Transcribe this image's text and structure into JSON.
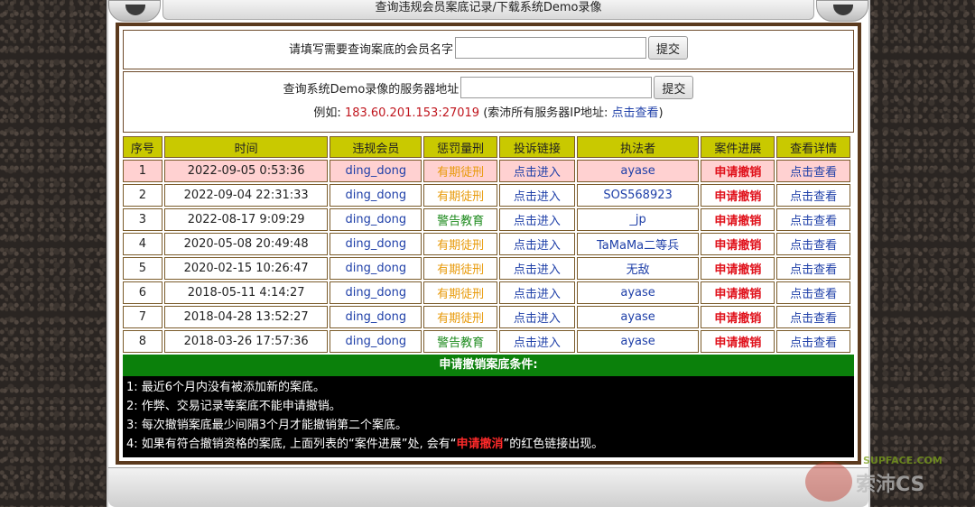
{
  "header": {
    "title": "查询违规会员案底记录/下载系统Demo录像"
  },
  "query_member": {
    "label": "请填写需要查询案底的会员名字",
    "value": "",
    "submit": "提交"
  },
  "query_server": {
    "label": "查询系统Demo录像的服务器地址",
    "value": "",
    "submit": "提交"
  },
  "example": {
    "prefix": "例如:",
    "address": "183.60.201.153:27019",
    "mid": "(索沛所有服务器IP地址:",
    "link": "点击查看",
    "suffix": ")"
  },
  "table": {
    "headers": [
      "序号",
      "时间",
      "违规会员",
      "惩罚量刑",
      "投诉链接",
      "执法者",
      "案件进展",
      "查看详情"
    ],
    "rows": [
      {
        "no": "1",
        "time": "2022-09-05 0:53:36",
        "member": "ding_dong",
        "penalty": "有期徒刑",
        "penalty_kind": "orange",
        "link": "点击进入",
        "officer": "ayase",
        "progress": "申请撤销",
        "detail": "点击查看"
      },
      {
        "no": "2",
        "time": "2022-09-04 22:31:33",
        "member": "ding_dong",
        "penalty": "有期徒刑",
        "penalty_kind": "orange",
        "link": "点击进入",
        "officer": "SOS568923",
        "progress": "申请撤销",
        "detail": "点击查看"
      },
      {
        "no": "3",
        "time": "2022-08-17 9:09:29",
        "member": "ding_dong",
        "penalty": "警告教育",
        "penalty_kind": "green",
        "link": "点击进入",
        "officer": "_jp",
        "progress": "申请撤销",
        "detail": "点击查看"
      },
      {
        "no": "4",
        "time": "2020-05-08 20:49:48",
        "member": "ding_dong",
        "penalty": "有期徒刑",
        "penalty_kind": "orange",
        "link": "点击进入",
        "officer": "TaMaMa二等兵",
        "progress": "申请撤销",
        "detail": "点击查看"
      },
      {
        "no": "5",
        "time": "2020-02-15 10:26:47",
        "member": "ding_dong",
        "penalty": "有期徒刑",
        "penalty_kind": "orange",
        "link": "点击进入",
        "officer": "无敌",
        "progress": "申请撤销",
        "detail": "点击查看"
      },
      {
        "no": "6",
        "time": "2018-05-11 4:14:27",
        "member": "ding_dong",
        "penalty": "有期徒刑",
        "penalty_kind": "orange",
        "link": "点击进入",
        "officer": "ayase",
        "progress": "申请撤销",
        "detail": "点击查看"
      },
      {
        "no": "7",
        "time": "2018-04-28 13:52:27",
        "member": "ding_dong",
        "penalty": "有期徒刑",
        "penalty_kind": "orange",
        "link": "点击进入",
        "officer": "ayase",
        "progress": "申请撤销",
        "detail": "点击查看"
      },
      {
        "no": "8",
        "time": "2018-03-26 17:57:36",
        "member": "ding_dong",
        "penalty": "警告教育",
        "penalty_kind": "green",
        "link": "点击进入",
        "officer": "ayase",
        "progress": "申请撤销",
        "detail": "点击查看"
      }
    ]
  },
  "conditions": {
    "title": "申请撤销案底条件:",
    "items": [
      "1:  最近6个月内没有被添加新的案底。",
      "2:  作弊、交易记录等案底不能申请撤销。",
      "3:  每次撤销案底最少间隔3个月才能撤销第二个案底。"
    ],
    "item4_pre": "4:  如果有符合撤销资格的案底, 上面列表的“案件进展”处, 会有“",
    "item4_hot": "申请撤消",
    "item4_post": "”的红色链接出现。"
  },
  "watermark": {
    "text1": "SUPFACE.COM",
    "text2": "索沛CS"
  },
  "colors": {
    "header_yellow": "#c9c900",
    "highlight_row": "#ffd1d1",
    "green_bar": "#0b800b",
    "frame_brown": "#5b3a1e"
  }
}
